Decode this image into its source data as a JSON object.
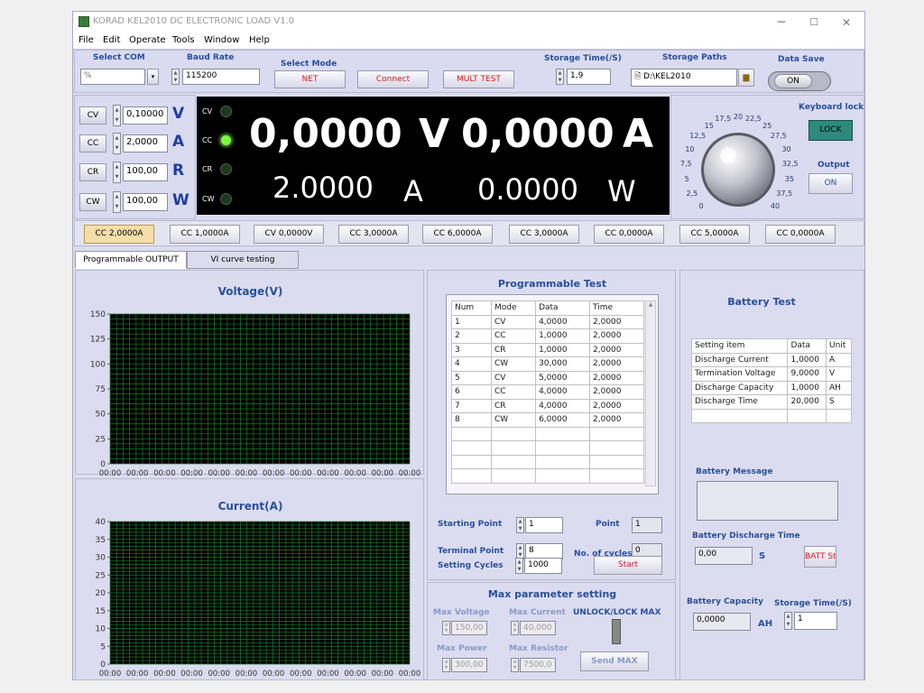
{
  "window": {
    "title": "KORAD KEL2010 DC ELECTRONIC LOAD V1.0",
    "minimize": "─",
    "maximize": "☐",
    "close": "✕"
  },
  "menu": [
    "File",
    "Edit",
    "Operate",
    "Tools",
    "Window",
    "Help"
  ],
  "top": {
    "select_com_label": "Select COM",
    "com_value": "%",
    "baud_label": "Baud Rate",
    "baud_value": "115200",
    "select_mode_label": "Select Mode",
    "net": "NET",
    "connect": "Connect",
    "mult_test": "MULT TEST",
    "storage_time_label": "Storage Time(/S)",
    "storage_time_value": "1,9",
    "storage_paths_label": "Storage Paths",
    "storage_path_value": "D:\\KEL2010",
    "data_save_label": "Data Save",
    "data_save_state": "ON"
  },
  "modes": [
    {
      "name": "CV",
      "value": "0,10000",
      "unit": "V"
    },
    {
      "name": "CC",
      "value": "2,0000",
      "unit": "A"
    },
    {
      "name": "CR",
      "value": "100,00",
      "unit": "R"
    },
    {
      "name": "CW",
      "value": "100,00",
      "unit": "W"
    }
  ],
  "display": {
    "leds": [
      "CV",
      "CC",
      "CR",
      "CW"
    ],
    "voltage": "0,0000",
    "voltage_unit": "V",
    "current": "0,0000",
    "current_unit": "A",
    "set_value": "2.0000",
    "set_unit": "A",
    "power": "0.0000",
    "power_unit": "W"
  },
  "knob": {
    "labels": [
      "0",
      "2,5",
      "5",
      "7,5",
      "10",
      "12,5",
      "15",
      "17,5",
      "20",
      "22,5",
      "25",
      "27,5",
      "30",
      "32,5",
      "35",
      "37,5",
      "40"
    ]
  },
  "keyboard": {
    "label": "Keyboard lock",
    "lock": "LOCK",
    "output_label": "Output",
    "output_state": "ON"
  },
  "presets": [
    "CC 2,0000A",
    "CC 1,0000A",
    "CV 0,0000V",
    "CC 3,0000A",
    "CC 6,0000A",
    "CC 3,0000A",
    "CC 0,0000A",
    "CC 5,0000A",
    "CC 0,0000A"
  ],
  "tabs": [
    "Programmable OUTPUT",
    "VI curve testing"
  ],
  "voltage_chart": {
    "title": "Voltage(V)",
    "y_ticks": [
      "150",
      "125",
      "100",
      "75",
      "50",
      "25",
      "0"
    ],
    "x_ticks": [
      "00:00",
      "00:00",
      "00:00",
      "00:00",
      "00:00",
      "00:00",
      "00:00",
      "00:00",
      "00:00",
      "00:00",
      "00:00",
      "00:00"
    ]
  },
  "current_chart": {
    "title": "Current(A)",
    "y_ticks": [
      "40",
      "35",
      "30",
      "25",
      "20",
      "15",
      "10",
      "5",
      "0"
    ],
    "x_ticks": [
      "00:00",
      "00:00",
      "00:00",
      "00:00",
      "00:00",
      "00:00",
      "00:00",
      "00:00",
      "00:00",
      "00:00",
      "00:00",
      "00:00"
    ]
  },
  "programmable": {
    "title": "Programmable Test",
    "headers": [
      "Num",
      "Mode",
      "Data",
      "Time"
    ],
    "rows": [
      [
        "1",
        "CV",
        "4,0000",
        "2,0000"
      ],
      [
        "2",
        "CC",
        "1,0000",
        "2,0000"
      ],
      [
        "3",
        "CR",
        "1,0000",
        "2,0000"
      ],
      [
        "4",
        "CW",
        "30,000",
        "2,0000"
      ],
      [
        "5",
        "CV",
        "5,0000",
        "2,0000"
      ],
      [
        "6",
        "CC",
        "4,0000",
        "2,0000"
      ],
      [
        "7",
        "CR",
        "4,0000",
        "2,0000"
      ],
      [
        "8",
        "CW",
        "6,0000",
        "2,0000"
      ]
    ],
    "starting_point_label": "Starting Point",
    "starting_point": "1",
    "terminal_point_label": "Terminal Point",
    "terminal_point": "8",
    "setting_cycles_label": "Setting Cycles",
    "setting_cycles": "1000",
    "point_label": "Point",
    "point": "1",
    "cycles_label": "No. of cycles",
    "cycles": "0",
    "start": "Start"
  },
  "maxparam": {
    "title": "Max parameter setting",
    "max_voltage_label": "Max Voltage",
    "max_voltage": "150,00",
    "max_current_label": "Max Current",
    "max_current": "40,000",
    "max_power_label": "Max Power",
    "max_power": "300,00",
    "max_resistor_label": "Max Resistor",
    "max_resistor": "7500,0",
    "unlock_label": "UNLOCK/LOCK MAX",
    "send_max": "Send MAX"
  },
  "battery": {
    "title": "Battery Test",
    "headers": [
      "Setting item",
      "Data",
      "Unit"
    ],
    "rows": [
      [
        "Discharge Current",
        "1,0000",
        "A"
      ],
      [
        "Termination Voltage",
        "9,0000",
        "V"
      ],
      [
        "Discharge Capacity",
        "1,0000",
        "AH"
      ],
      [
        "Discharge Time",
        "20,000",
        "S"
      ]
    ],
    "message_label": "Battery Message",
    "discharge_time_label": "Battery Discharge Time",
    "discharge_time": "0,00",
    "discharge_time_unit": "S",
    "batt_start": "BATT Start",
    "capacity_label": "Battery Capacity",
    "capacity": "0,0000",
    "capacity_unit": "AH",
    "storage_time_label": "Storage Time(/S)",
    "storage_time": "1"
  },
  "colors": {
    "accent": "#28509c",
    "led_on": "#7aff3a",
    "red_text": "#d21e1e",
    "selected_preset": "#f4deaa",
    "lock_button": "#2e8a7e"
  }
}
